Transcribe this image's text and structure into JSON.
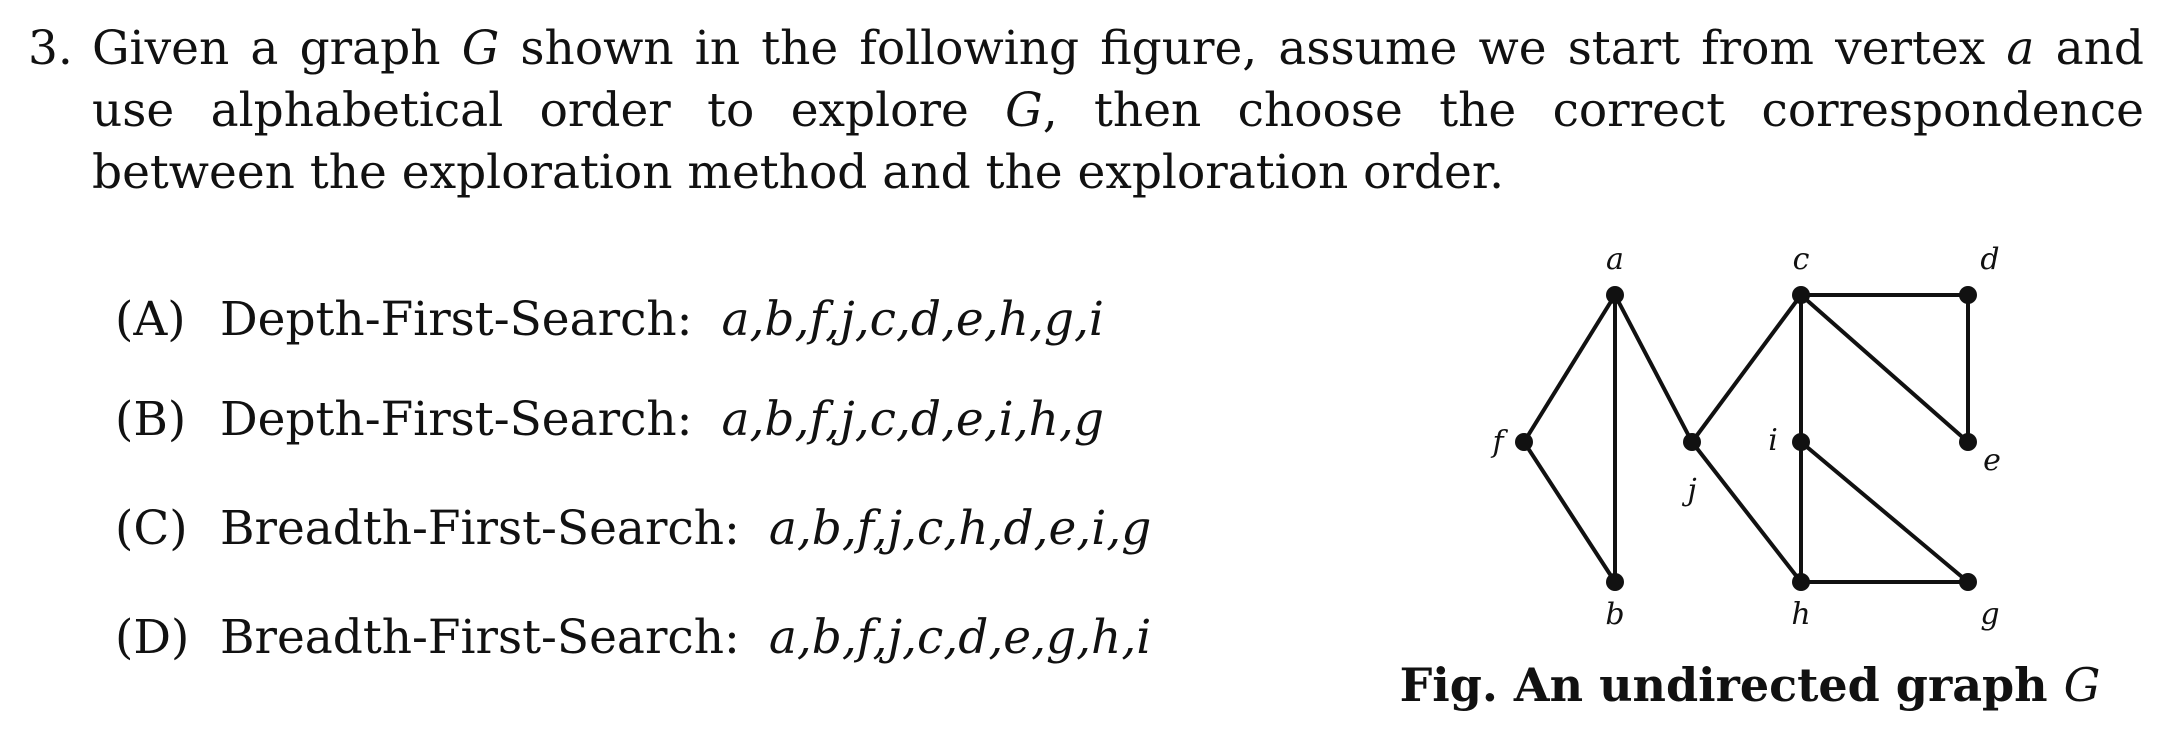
{
  "question": {
    "number": "3.",
    "text_1": "Given a graph ",
    "G1": "G",
    "text_2": " shown in the following figure, assume we start from vertex ",
    "a": "a",
    "text_3": " and use alphabetical order to explore ",
    "G2": "G",
    "text_4": ", then choose the correct correspondence between the exploration method and the exploration order."
  },
  "options": [
    {
      "label": "(A)",
      "method": "Depth-First-Search:",
      "sequence": "a,b,f,j,c,d,e,h,g,i"
    },
    {
      "label": "(B)",
      "method": "Depth-First-Search:",
      "sequence": "a,b,f,j,c,d,e,i,h,g"
    },
    {
      "label": "(C)",
      "method": "Breadth-First-Search:",
      "sequence": "a,b,f,j,c,h,d,e,i,g"
    },
    {
      "label": "(D)",
      "method": "Breadth-First-Search:",
      "sequence": "a,b,f,j,c,d,e,g,h,i"
    }
  ],
  "figure": {
    "caption_prefix": "Fig.  An undirected graph ",
    "caption_var": "G",
    "vertices": [
      "a",
      "b",
      "c",
      "d",
      "e",
      "f",
      "g",
      "h",
      "i",
      "j"
    ],
    "edges": [
      [
        "a",
        "f"
      ],
      [
        "a",
        "b"
      ],
      [
        "a",
        "j"
      ],
      [
        "f",
        "b"
      ],
      [
        "j",
        "c"
      ],
      [
        "j",
        "h"
      ],
      [
        "c",
        "d"
      ],
      [
        "c",
        "e"
      ],
      [
        "c",
        "h"
      ],
      [
        "d",
        "e"
      ],
      [
        "i",
        "h"
      ],
      [
        "i",
        "g"
      ],
      [
        "h",
        "g"
      ]
    ]
  }
}
